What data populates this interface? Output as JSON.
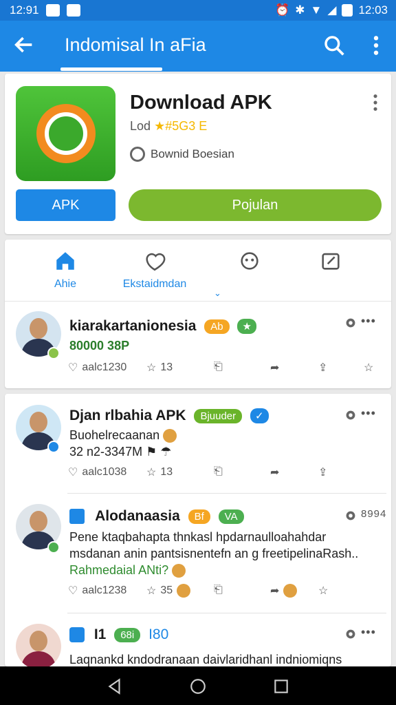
{
  "status_bar": {
    "left_time": "12:91",
    "right_time": "12:03"
  },
  "app_bar": {
    "title": "Indomisal In aFia"
  },
  "app": {
    "name": "Download APK",
    "rating_text": "Lod",
    "rating_value": "★#5G3 E",
    "developer": "Bownid Boesian",
    "apk_button": "APK",
    "green_button": "Pojulan"
  },
  "tabs": [
    {
      "label": "Ahie"
    },
    {
      "label": "Ekstaidmdan"
    },
    {
      "label": ""
    },
    {
      "label": ""
    }
  ],
  "posts": [
    {
      "name": "kiarakartanionesia",
      "badge": "Ab",
      "sub": "80000 38P",
      "likes": "aalc1230",
      "stars": "13"
    },
    {
      "name": "Djan rlbahia APK",
      "badge": "Bjuuder",
      "line1": "Buohelrecaanan",
      "line2": "32 n2-3347M",
      "likes": "aalc1038",
      "stars": "13"
    },
    {
      "name": "Alodanaasia",
      "badge1": "Bf",
      "badge2": "VA",
      "line1": "Pene ktaqbahapta thnkasl hpdarnaulloahahdar",
      "line2": "msdanan anin pantsisnentefn an g freetipelinaRash..",
      "line3": "Rahmedaial ANti?",
      "likes": "aalc1238",
      "stars": "35",
      "count": "8994"
    },
    {
      "name": "I1",
      "badge1": "68i",
      "badge2": "I80",
      "line1": "Laqnankd kndodranaan daivlaridhanl indniomiqns"
    }
  ],
  "colors": {
    "primary": "#1e88e5",
    "green": "#7cb82f",
    "orange": "#f5a623"
  }
}
